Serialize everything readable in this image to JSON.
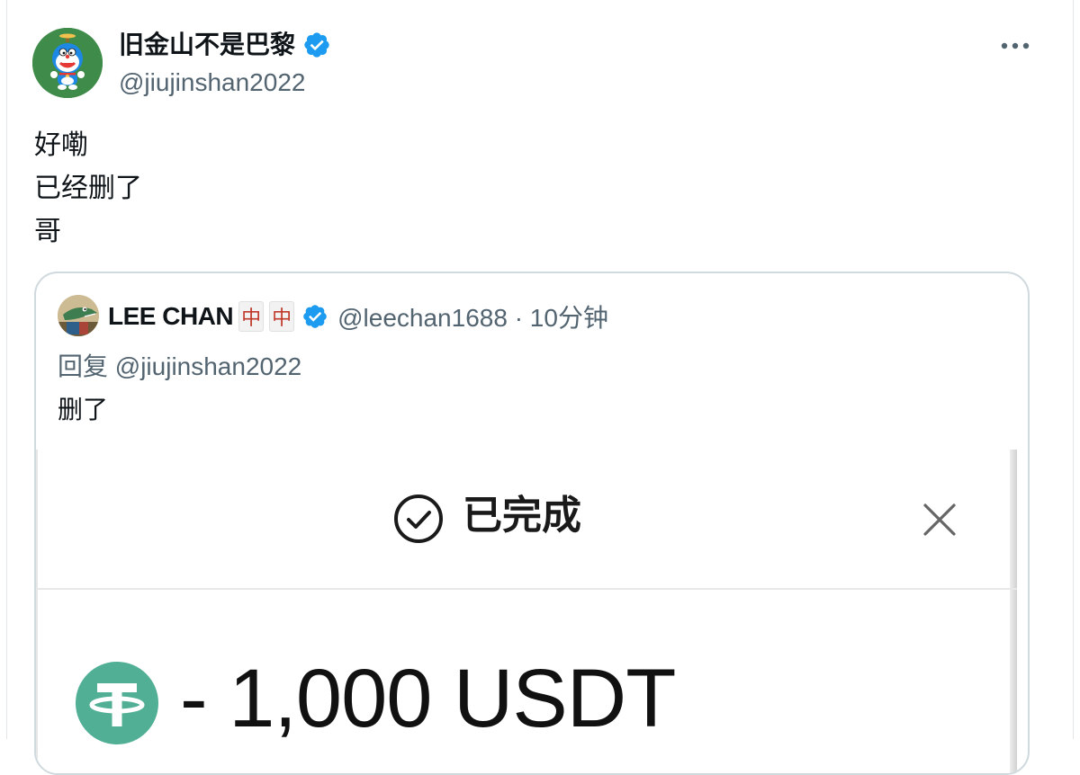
{
  "tweet": {
    "author": {
      "display_name": "旧金山不是巴黎",
      "handle": "@jiujinshan2022",
      "verified": true,
      "avatar_icon": "doraemon-avatar-icon"
    },
    "more_icon": "more-dots-icon",
    "text_lines": [
      "好嘞",
      "已经删了",
      "哥"
    ]
  },
  "quote": {
    "author": {
      "display_name": "LEE CHAN",
      "mahjong_tiles": [
        "中",
        "中"
      ],
      "handle_time": "@leechan1688 · 10分钟",
      "verified": true,
      "avatar_icon": "crocodile-avatar-icon"
    },
    "reply_to": "回复 @jiujinshan2022",
    "text": "删了",
    "media": {
      "status_title": "已完成",
      "status_icon": "check-circle-icon",
      "close_icon": "close-icon",
      "coin_icon": "tether-coin-icon",
      "amount": "- 1,000 USDT"
    }
  },
  "colors": {
    "verified_blue": "#1d9bf0",
    "secondary_text": "#536471",
    "tether_green": "#50af95",
    "avatar_green": "#3f8b4a"
  }
}
